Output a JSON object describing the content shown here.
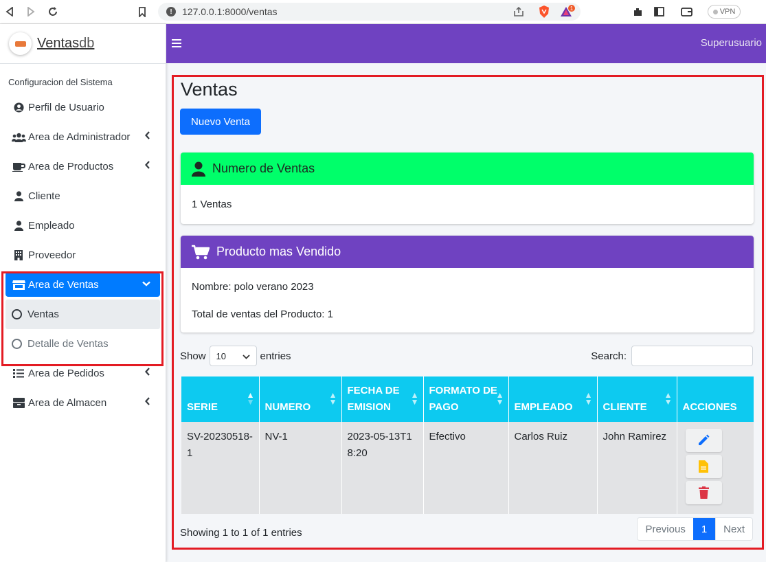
{
  "browser": {
    "url": "127.0.0.1:8000/ventas",
    "vpn_label": "VPN",
    "notif_count": "1"
  },
  "brand": {
    "name": "Ventas",
    "suffix": "db"
  },
  "sidebar": {
    "header": "Configuracion del Sistema",
    "items": [
      {
        "label": "Perfil de Usuario"
      },
      {
        "label": "Area de Administrador"
      },
      {
        "label": "Area de Productos"
      },
      {
        "label": "Cliente"
      },
      {
        "label": "Empleado"
      },
      {
        "label": "Proveedor"
      },
      {
        "label": "Area de Ventas"
      },
      {
        "label": "Area de Pedidos"
      },
      {
        "label": "Area de Almacen"
      }
    ],
    "sub_items": [
      {
        "label": "Ventas"
      },
      {
        "label": "Detalle de Ventas"
      }
    ]
  },
  "topbar": {
    "user": "Superusuario"
  },
  "page": {
    "title": "Ventas",
    "new_button": "Nuevo Venta"
  },
  "card_count": {
    "title": "Numero de Ventas",
    "body": "1 Ventas",
    "color": "#00ff6a"
  },
  "card_product": {
    "title": "Producto mas Vendido",
    "name_line": "Nombre: polo verano 2023",
    "total_line": "Total de ventas del Producto: 1",
    "color": "#6f42c1"
  },
  "table_controls": {
    "show_label": "Show",
    "entries_value": "10",
    "entries_label": "entries",
    "search_label": "Search:"
  },
  "table": {
    "headers": [
      "SERIE",
      "NUMERO",
      "FECHA DE EMISION",
      "FORMATO DE PAGO",
      "EMPLEADO",
      "CLIENTE",
      "ACCIONES"
    ],
    "rows": [
      {
        "serie": "SV-20230518-1",
        "numero": "NV-1",
        "fecha": "2023-05-13T18:20",
        "formato": "Efectivo",
        "empleado": "Carlos Ruiz",
        "cliente": "John Ramirez"
      }
    ]
  },
  "footer": {
    "info": "Showing 1 to 1 of 1 entries",
    "previous": "Previous",
    "page": "1",
    "next": "Next"
  }
}
